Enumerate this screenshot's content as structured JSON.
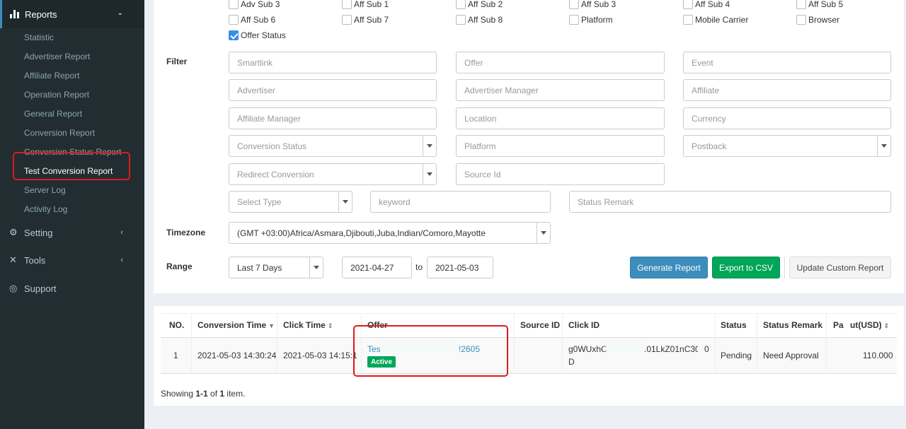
{
  "sidebar": {
    "section_title": "Reports",
    "items": [
      {
        "label": "Statistic"
      },
      {
        "label": "Advertiser Report"
      },
      {
        "label": "Affiliate Report"
      },
      {
        "label": "Operation Report"
      },
      {
        "label": "General Report"
      },
      {
        "label": "Conversion Report"
      },
      {
        "label": "Conversion Status Report"
      },
      {
        "label": "Test Conversion Report"
      },
      {
        "label": "Server Log"
      },
      {
        "label": "Activity Log"
      }
    ],
    "menus": [
      {
        "label": "Setting"
      },
      {
        "label": "Tools"
      },
      {
        "label": "Support"
      }
    ]
  },
  "columns_checkboxes": [
    {
      "label": "Adv Sub 3",
      "checked": false
    },
    {
      "label": "Aff Sub 1",
      "checked": false
    },
    {
      "label": "Aff Sub 2",
      "checked": false
    },
    {
      "label": "Aff Sub 3",
      "checked": false
    },
    {
      "label": "Aff Sub 4",
      "checked": false
    },
    {
      "label": "Aff Sub 5",
      "checked": false
    },
    {
      "label": "Aff Sub 6",
      "checked": false
    },
    {
      "label": "Aff Sub 7",
      "checked": false
    },
    {
      "label": "Aff Sub 8",
      "checked": false
    },
    {
      "label": "Platform",
      "checked": false
    },
    {
      "label": "Mobile Carrier",
      "checked": false
    },
    {
      "label": "Browser",
      "checked": false
    },
    {
      "label": "Offer Status",
      "checked": true
    }
  ],
  "filter": {
    "label": "Filter",
    "smartlink": "Smartlink",
    "offer": "Offer",
    "event": "Event",
    "advertiser": "Advertiser",
    "advertiser_manager": "Advertiser Manager",
    "affiliate": "Affiliate",
    "affiliate_manager": "Affiliate Manager",
    "location": "Location",
    "currency": "Currency",
    "conversion_status": "Conversion Status",
    "platform": "Platform",
    "postback": "Postback",
    "redirect_conversion": "Redirect Conversion",
    "source_id": "Source Id",
    "select_type": "Select Type",
    "keyword": "keyword",
    "status_remark": "Status Remark"
  },
  "timezone": {
    "label": "Timezone",
    "value": "(GMT +03:00)Africa/Asmara,Djibouti,Juba,Indian/Comoro,Mayotte"
  },
  "range": {
    "label": "Range",
    "preset": "Last 7 Days",
    "from": "2021-04-27",
    "to_label": "to",
    "to": "2021-05-03"
  },
  "actions": {
    "generate": "Generate Report",
    "export": "Export to CSV",
    "update_custom": "Update Custom Report"
  },
  "table": {
    "headers": {
      "no": "NO.",
      "conversion_time": "Conversion Time",
      "click_time": "Click Time",
      "offer": "Offer",
      "source_id": "Source ID",
      "click_id": "Click ID",
      "status": "Status",
      "status_remark": "Status Remark",
      "payout_prefix": "Pa",
      "payout_suffix": "ut(USD)"
    },
    "rows": [
      {
        "no": "1",
        "conversion_time": "2021-05-03 14:30:24",
        "click_time": "2021-05-03 14:15:18",
        "offer_prefix": "Tes",
        "offer_suffix": "!2605",
        "offer_badge": "Active",
        "source_id": "",
        "click_id_prefix": "g0WUxhC",
        "click_id_suffix": ".01LkZ01nC30",
        "click_id_line2": "D",
        "extra": "0",
        "status": "Pending",
        "status_remark": "Need Approval",
        "payout": "110.000"
      }
    ]
  },
  "footer": {
    "prefix": "Showing ",
    "range": "1-1",
    "of": " of ",
    "total": "1",
    "suffix": " item."
  }
}
